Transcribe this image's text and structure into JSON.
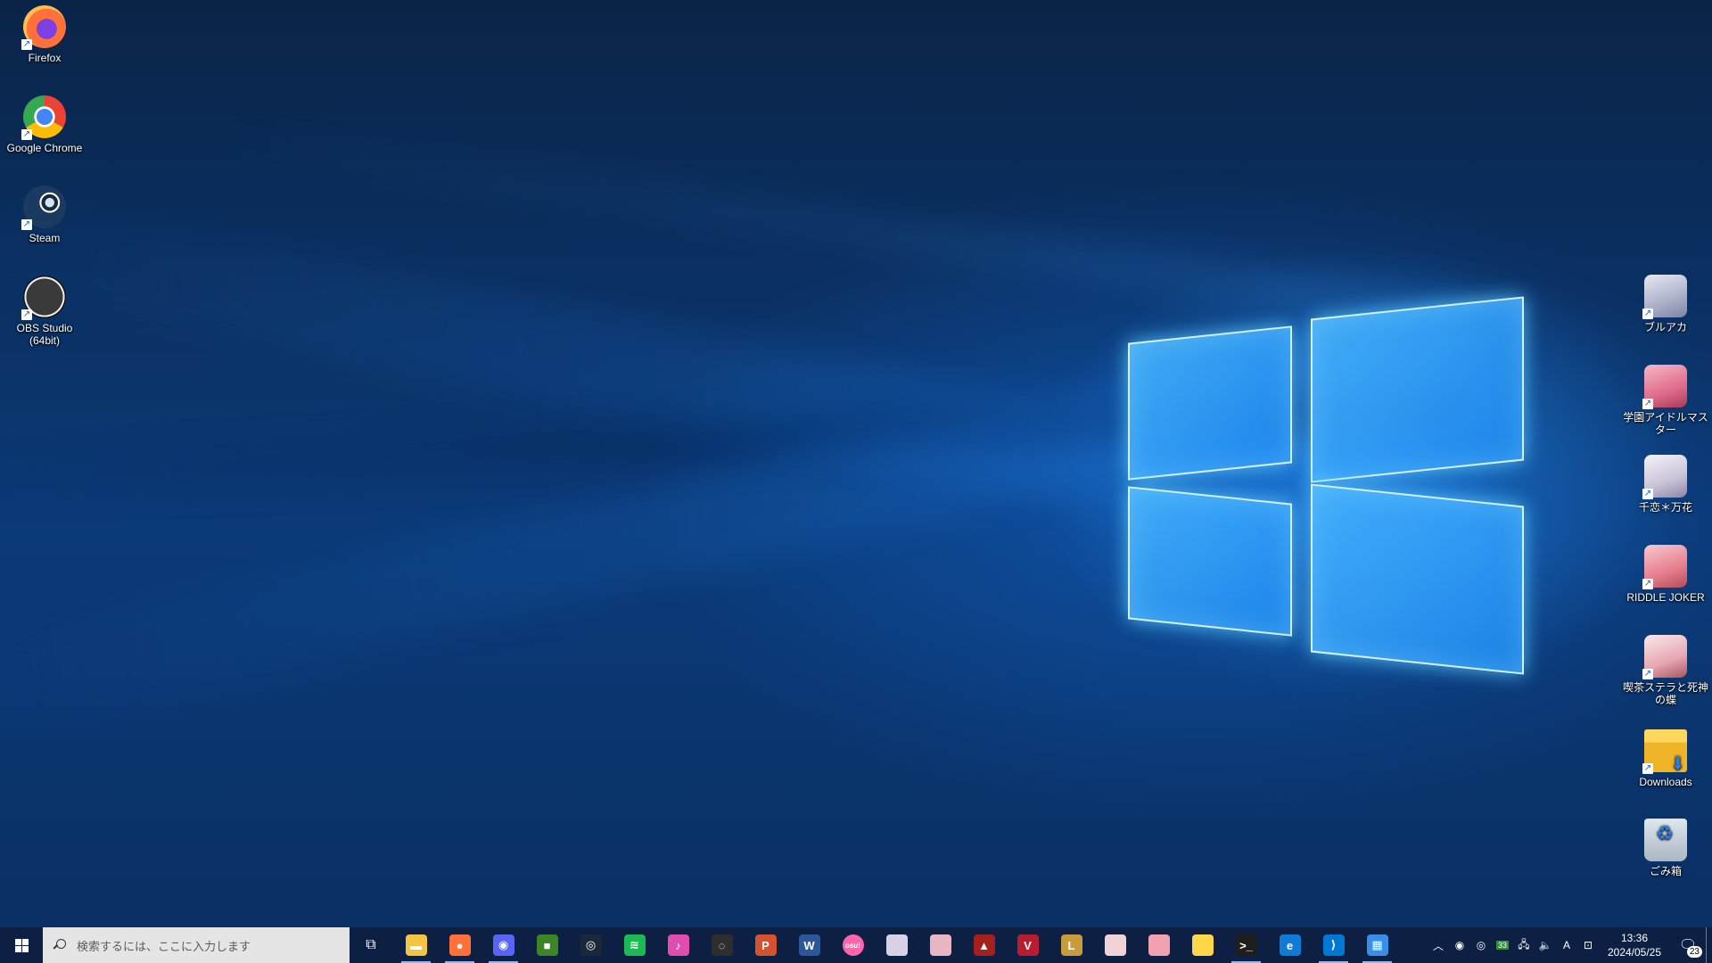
{
  "desktop": {
    "left_icons": [
      {
        "label": "Firefox",
        "icon": "firefox-icon"
      },
      {
        "label": "Google Chrome",
        "icon": "chrome-icon"
      },
      {
        "label": "Steam",
        "icon": "steam-icon"
      },
      {
        "label": "OBS Studio (64bit)",
        "icon": "obs-icon"
      }
    ],
    "right_icons": [
      {
        "label": "ブルアカ",
        "icon": "anime-shortcut-icon"
      },
      {
        "label": "学園アイドルマスター",
        "icon": "anime-shortcut-icon"
      },
      {
        "label": "千恋＊万花",
        "icon": "anime-shortcut-icon"
      },
      {
        "label": "RIDDLE JOKER",
        "icon": "anime-shortcut-icon"
      },
      {
        "label": "喫茶ステラと死神の蝶",
        "icon": "anime-shortcut-icon"
      },
      {
        "label": "Downloads",
        "icon": "folder-download-icon"
      },
      {
        "label": "ごみ箱",
        "icon": "recycle-bin-icon"
      }
    ]
  },
  "taskbar": {
    "search_placeholder": "検索するには、ここに入力します",
    "pinned_apps": [
      {
        "name": "File Explorer",
        "icon": "folder-icon",
        "color": "#f4c542",
        "glyph": "▬",
        "running": true
      },
      {
        "name": "Firefox",
        "icon": "firefox-icon",
        "color": "#ff7139",
        "glyph": "●",
        "running": true
      },
      {
        "name": "Discord",
        "icon": "discord-icon",
        "color": "#5865f2",
        "glyph": "◉",
        "running": true
      },
      {
        "name": "Minecraft",
        "icon": "minecraft-icon",
        "color": "#3c8527",
        "glyph": "■",
        "running": false
      },
      {
        "name": "Steam",
        "icon": "steam-icon",
        "color": "#1b2838",
        "glyph": "◎",
        "running": false
      },
      {
        "name": "Spotify",
        "icon": "spotify-icon",
        "color": "#1db954",
        "glyph": "≋",
        "running": false
      },
      {
        "name": "iTunes",
        "icon": "music-icon",
        "color": "#e04cb0",
        "glyph": "♪",
        "running": false
      },
      {
        "name": "OBS Studio",
        "icon": "obs-icon",
        "color": "#2e2e2e",
        "glyph": "◌",
        "running": false
      },
      {
        "name": "PowerPoint",
        "icon": "powerpoint-icon",
        "color": "#d35230",
        "glyph": "P",
        "running": false
      },
      {
        "name": "Word",
        "icon": "word-icon",
        "color": "#2b579a",
        "glyph": "W",
        "running": false
      },
      {
        "name": "osu!",
        "icon": "osu-icon",
        "color": "#ff66aa",
        "glyph": "osu!",
        "running": false
      },
      {
        "name": "Game 1",
        "icon": "anime-game-icon",
        "color": "#d9d2e6",
        "glyph": "",
        "running": false
      },
      {
        "name": "Game 2",
        "icon": "anime-game-icon",
        "color": "#e8b5c2",
        "glyph": "",
        "running": false
      },
      {
        "name": "Apex Legends",
        "icon": "apex-icon",
        "color": "#a3201f",
        "glyph": "▲",
        "running": false
      },
      {
        "name": "Valorant",
        "icon": "valorant-icon",
        "color": "#b91c2e",
        "glyph": "V",
        "running": false
      },
      {
        "name": "League of Legends",
        "icon": "lol-icon",
        "color": "#c89b3c",
        "glyph": "L",
        "running": false
      },
      {
        "name": "Game 3",
        "icon": "anime-game-icon",
        "color": "#f0d3d8",
        "glyph": "",
        "running": false
      },
      {
        "name": "Game 4",
        "icon": "anime-game-icon",
        "color": "#f2a1b0",
        "glyph": "",
        "running": false
      },
      {
        "name": "Sticky Notes",
        "icon": "sticky-notes-icon",
        "color": "#ffd54a",
        "glyph": "",
        "running": false
      },
      {
        "name": "Terminal",
        "icon": "terminal-icon",
        "color": "#1e1e1e",
        "glyph": ">_",
        "running": true
      },
      {
        "name": "Edge",
        "icon": "edge-icon",
        "color": "#0f7bd6",
        "glyph": "e",
        "running": false
      },
      {
        "name": "VS Code",
        "icon": "vscode-icon",
        "color": "#0078d4",
        "glyph": "⟩",
        "running": true
      },
      {
        "name": "Microsoft Store",
        "icon": "store-icon",
        "color": "#3a8ee6",
        "glyph": "▦",
        "running": true
      }
    ],
    "tray": {
      "temperature_badge": "33",
      "ime_indicator": "A",
      "time": "13:36",
      "date": "2024/05/25",
      "notification_count": "23"
    }
  }
}
